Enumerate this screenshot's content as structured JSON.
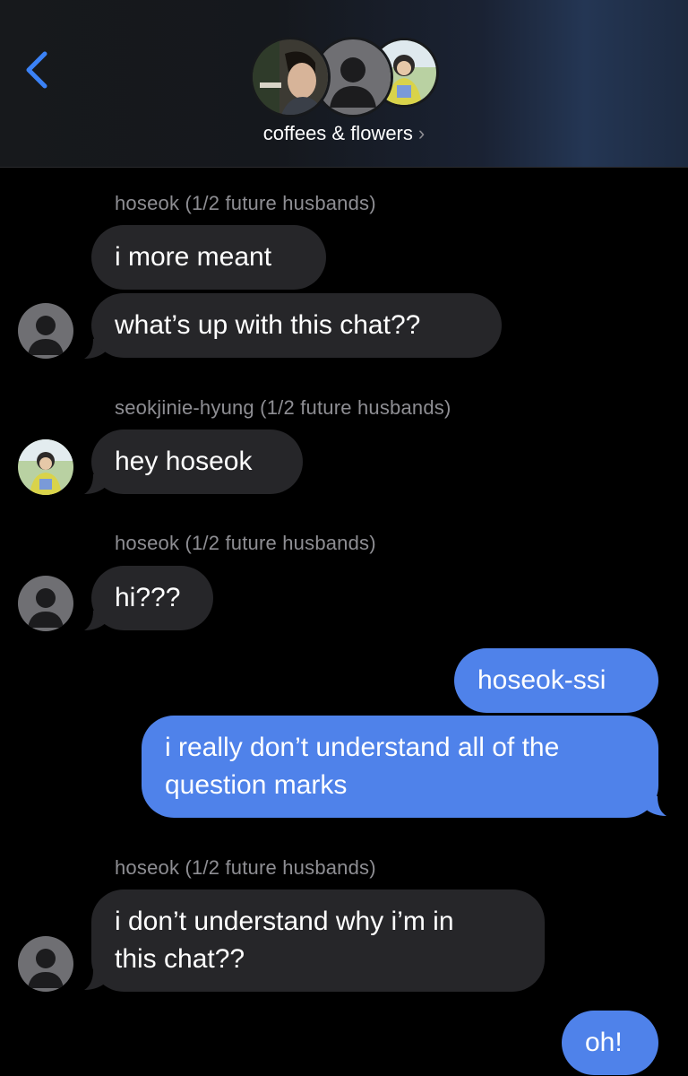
{
  "header": {
    "group_name": "coffees & flowers",
    "chevron": "›",
    "avatars": [
      {
        "name": "participant-photo-avatar"
      },
      {
        "name": "placeholder-person-avatar"
      },
      {
        "name": "participant-photo-avatar"
      }
    ]
  },
  "messages": [
    {
      "type": "sender",
      "text": "hoseok (1/2 future husbands)"
    },
    {
      "type": "incoming",
      "text": "i more meant"
    },
    {
      "type": "incoming",
      "text": "what’s up with this chat??"
    },
    {
      "type": "sender",
      "text": "seokjinie-hyung (1/2 future husbands)"
    },
    {
      "type": "incoming",
      "text": "hey hoseok"
    },
    {
      "type": "sender",
      "text": "hoseok (1/2 future husbands)"
    },
    {
      "type": "incoming",
      "text": "hi???"
    },
    {
      "type": "outgoing",
      "text": "hoseok-ssi"
    },
    {
      "type": "outgoing",
      "lines": [
        "i really don’t understand all of the",
        "question marks"
      ]
    },
    {
      "type": "sender",
      "text": "hoseok (1/2 future husbands)"
    },
    {
      "type": "incoming",
      "lines": [
        "i don’t understand why i’m in",
        "this chat??"
      ]
    },
    {
      "type": "outgoing",
      "text": "oh!"
    }
  ],
  "colors": {
    "incoming_bubble": "#262629",
    "outgoing_bubble": "#4f82ea",
    "accent": "#3b82f6",
    "sender_label": "#8e8e93"
  }
}
